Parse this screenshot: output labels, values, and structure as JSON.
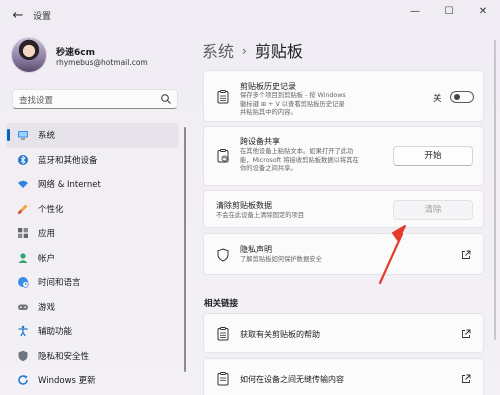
{
  "window": {
    "title": "设置",
    "back_icon": "back-arrow-icon",
    "controls": [
      "minimize-icon",
      "maximize-icon",
      "close-icon"
    ]
  },
  "user": {
    "name": "秒速6cm",
    "email": "rhymebus@hotmail.com"
  },
  "search": {
    "placeholder": "查找设置"
  },
  "nav": {
    "items": [
      {
        "label": "系统",
        "icon": "monitor-icon",
        "active": true
      },
      {
        "label": "蓝牙和其他设备",
        "icon": "bluetooth-icon"
      },
      {
        "label": "网络 & Internet",
        "icon": "wifi-icon"
      },
      {
        "label": "个性化",
        "icon": "brush-icon"
      },
      {
        "label": "应用",
        "icon": "apps-icon"
      },
      {
        "label": "帐户",
        "icon": "account-icon"
      },
      {
        "label": "时间和语言",
        "icon": "globe-clock-icon"
      },
      {
        "label": "游戏",
        "icon": "gamepad-icon"
      },
      {
        "label": "辅助功能",
        "icon": "accessibility-icon"
      },
      {
        "label": "隐私和安全性",
        "icon": "shield-icon"
      },
      {
        "label": "Windows 更新",
        "icon": "update-icon"
      }
    ]
  },
  "page": {
    "breadcrumb_parent": "系统",
    "breadcrumb_sep": "›",
    "title": "剪贴板"
  },
  "clipboard_history": {
    "title": "剪贴板历史记录",
    "desc_lines": [
      "保存多个项目到剪贴板 - 按 Windows",
      "徽标键 ⊞ + V 以查看剪贴板历史记录",
      "并粘贴其中的内容。"
    ],
    "toggle_label": "关",
    "toggle_on": false
  },
  "cross_device": {
    "title": "跨设备共享",
    "desc_lines": [
      "在其他设备上粘贴文本。如果打开了此功",
      "能，Microsoft 将接收剪贴板数据以将其在",
      "你的设备之间共享。"
    ],
    "button": "开始"
  },
  "clear_data": {
    "title": "清除剪贴板数据",
    "desc": "不会在此设备上清除固定的项目",
    "button": "清除"
  },
  "privacy": {
    "title": "隐私声明",
    "desc": "了解剪贴板如何保护数据安全"
  },
  "related": {
    "heading": "相关链接",
    "links": [
      {
        "label": "获取有关剪贴板的帮助"
      },
      {
        "label": "如何在设备之间无缝传输内容"
      }
    ]
  },
  "colors": {
    "accent": "#0067c0",
    "annotation_arrow": "#e43b2d"
  }
}
